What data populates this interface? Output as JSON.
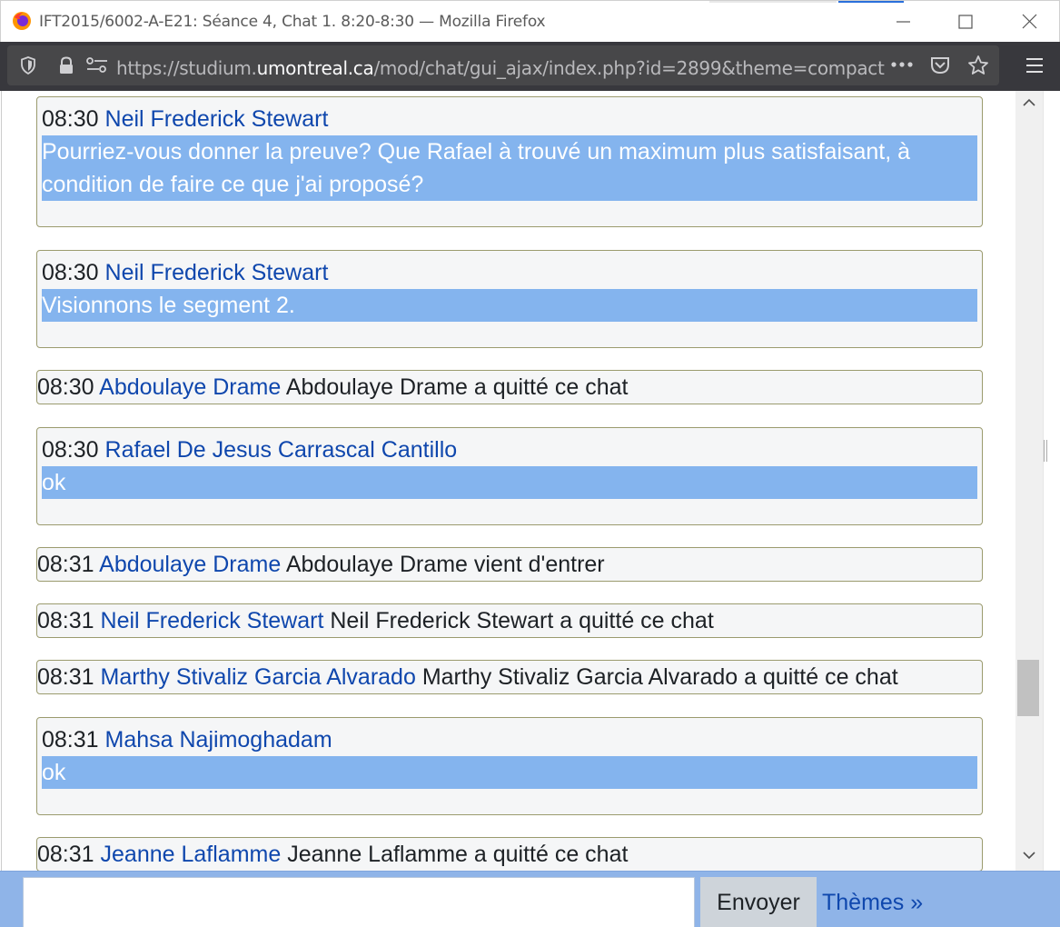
{
  "window": {
    "title": "IFT2015/6002-A-E21: Séance 4, Chat 1. 8:20-8:30 — Mozilla Firefox"
  },
  "navbar": {
    "url_prefix": "https://studium.",
    "url_host": "umontreal.ca",
    "url_path": "/mod/chat/gui_ajax/index.php?id=2899&theme=compact",
    "more_label": "•••"
  },
  "messages": [
    {
      "time": "08:30",
      "user": "Neil Frederick Stewart",
      "text": "Pourriez-vous donner la preuve? Que Rafael à trouvé un maximum plus satisfaisant, à",
      "text2": "condition de faire ce que j'ai proposé?"
    },
    {
      "time": "08:30",
      "user": "Neil Frederick Stewart",
      "text": "Visionnons le segment 2."
    },
    {
      "time": "08:30",
      "user": "Abdoulaye Drame",
      "event": "Abdoulaye Drame a quitté ce chat"
    },
    {
      "time": "08:30",
      "user": "Rafael De Jesus Carrascal Cantillo",
      "text": "ok"
    },
    {
      "time": "08:31",
      "user": "Abdoulaye Drame",
      "event": "Abdoulaye Drame vient d'entrer"
    },
    {
      "time": "08:31",
      "user": "Neil Frederick Stewart",
      "event": "Neil Frederick Stewart a quitté ce chat"
    },
    {
      "time": "08:31",
      "user": "Marthy Stivaliz Garcia Alvarado",
      "event": "Marthy Stivaliz Garcia Alvarado a quitté ce chat"
    },
    {
      "time": "08:31",
      "user": "Mahsa Najimoghadam",
      "text": "ok"
    },
    {
      "time": "08:31",
      "user": "Jeanne Laflamme",
      "event": "Jeanne Laflamme a quitté ce chat"
    }
  ],
  "input": {
    "value": "",
    "send_label": "Envoyer",
    "themes_label": "Thèmes »"
  },
  "colors": {
    "message_highlight": "#84b4ee",
    "user_link": "#0f47ad",
    "input_bar": "#8fb4e8",
    "browser_toolbar": "#38383d"
  }
}
